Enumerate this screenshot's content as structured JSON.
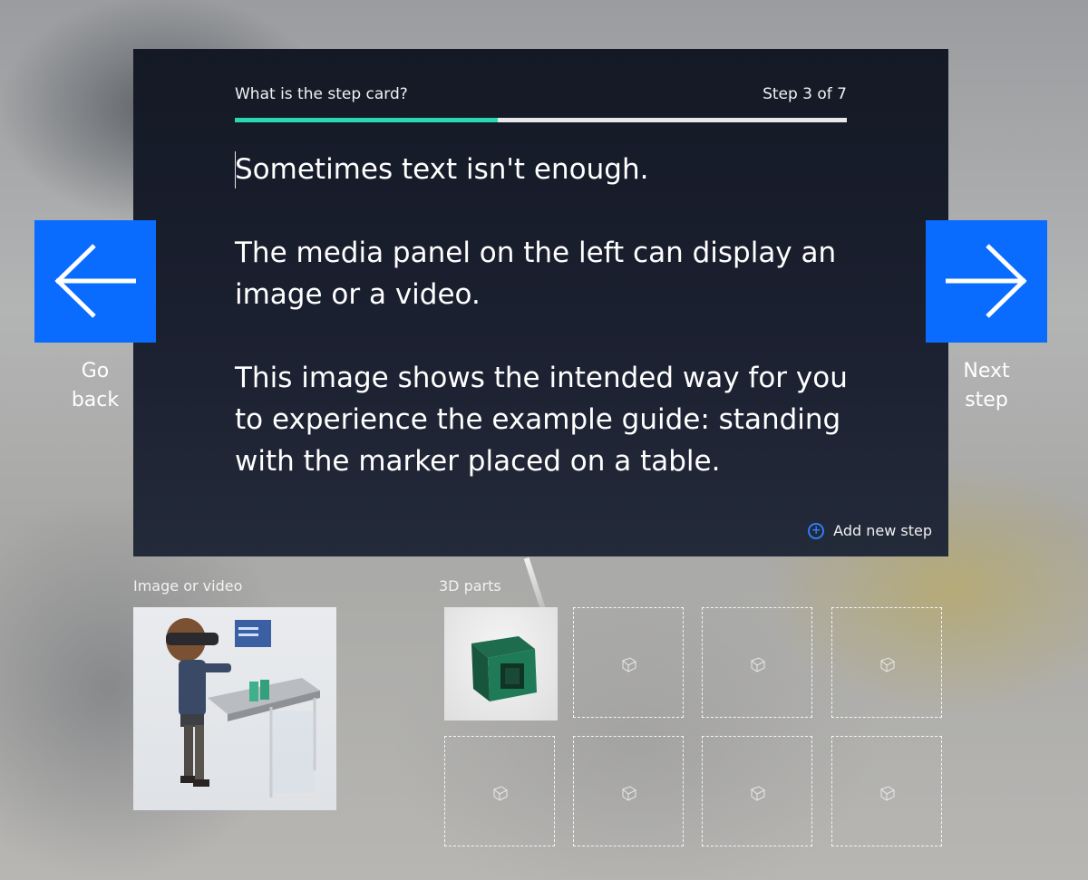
{
  "card": {
    "title": "What is the step card?",
    "step_indicator": "Step 3 of 7",
    "progress": 0.43,
    "paragraphs": [
      "Sometimes text isn't enough.",
      "The media panel on the left can display an image or a video.",
      "This image shows the intended way for you to experience the example guide: standing with the marker placed on a table."
    ],
    "add_step_label": "Add new step"
  },
  "nav": {
    "back_line1": "Go",
    "back_line2": "back",
    "next_line1": "Next",
    "next_line2": "step"
  },
  "media": {
    "label": "Image or video"
  },
  "parts": {
    "label": "3D parts",
    "slots": 8,
    "filled": 1
  },
  "colors": {
    "accent": "#0a6cff",
    "progress": "#2ad7b0",
    "card_bg": "#1b2030"
  }
}
